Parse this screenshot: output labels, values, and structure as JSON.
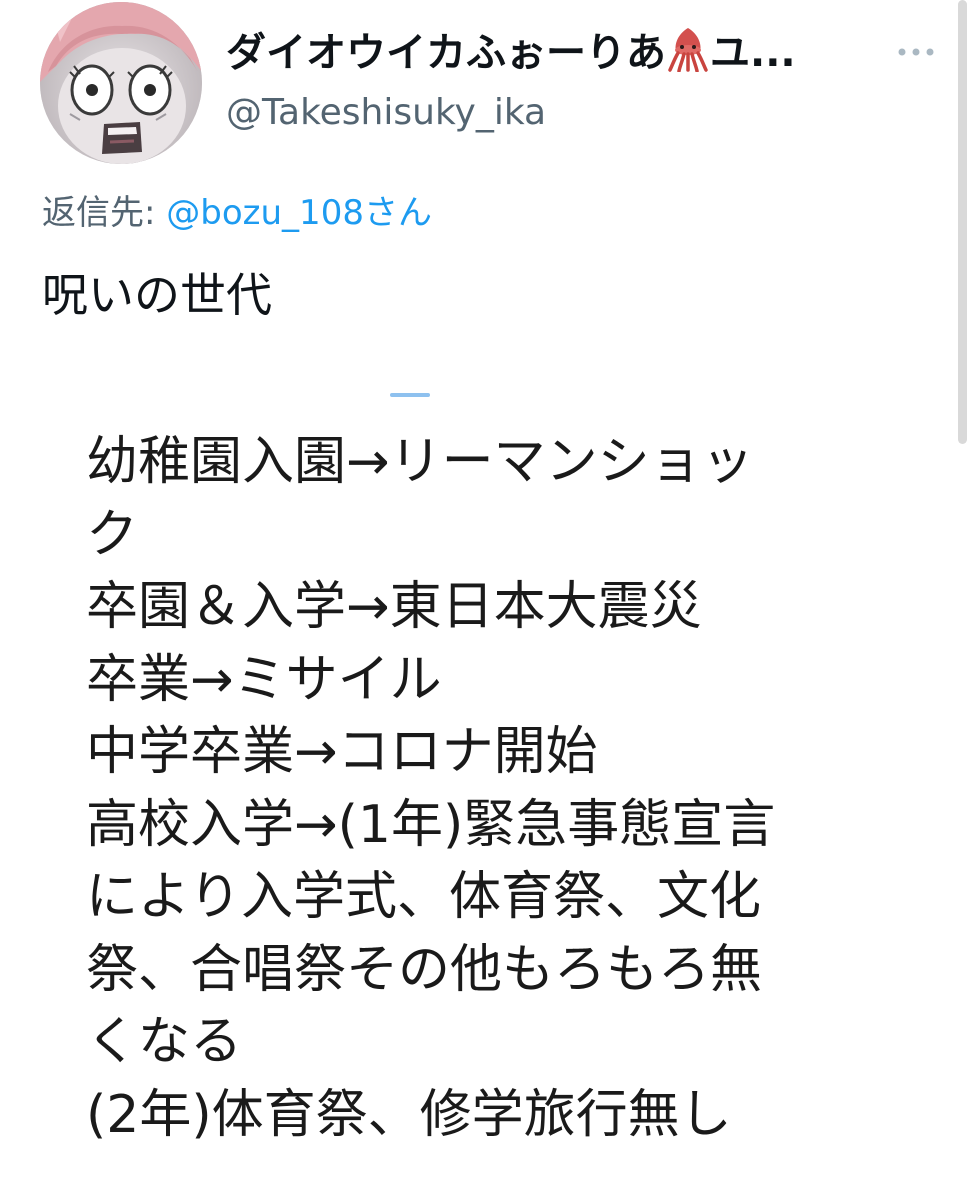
{
  "tweet": {
    "display_name": "ダイオウイカふぉーりあ",
    "display_name_suffix": "ユ...",
    "name_emoji_icon": "squid-emoji",
    "handle": "@Takeshisuky_ika",
    "reply_prefix": "返信先:",
    "reply_to": "@bozu_108さん",
    "text": "呪いの世代"
  },
  "attached_image": {
    "lines": [
      "幼稚園入園→リーマンショッ",
      "ク",
      "卒園＆入学→東日本大震災",
      "卒業→ミサイル",
      "中学卒業→コロナ開始",
      "高校入学→(1年)緊急事態宣言",
      "により入学式、体育祭、文化",
      "祭、合唱祭その他もろもろ無",
      "くなる",
      "(2年)体育祭、修学旅行無し"
    ]
  },
  "icons": {
    "more": "more-dots-icon",
    "avatar": "anime-face-avatar"
  },
  "colors": {
    "primary_text": "#0f1419",
    "secondary_text": "#536471",
    "link": "#1d9bf0"
  }
}
